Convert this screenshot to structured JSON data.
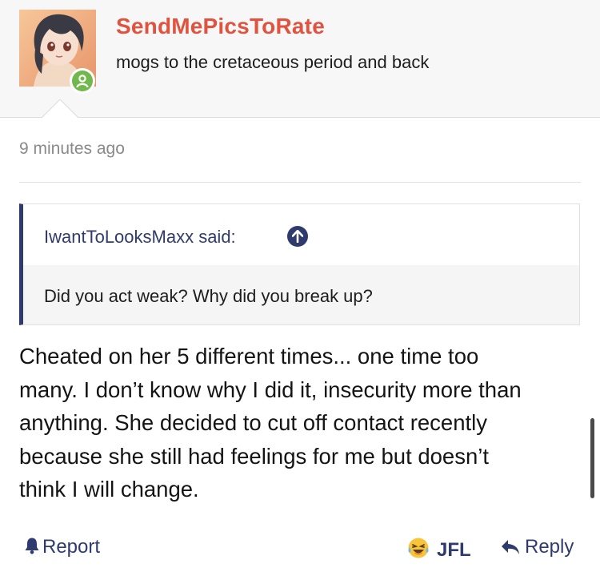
{
  "header": {
    "username": "SendMePicsToRate",
    "user_title": "mogs to the cretaceous period and back",
    "status": "online"
  },
  "post": {
    "timestamp": "9 minutes ago",
    "quote": {
      "author_label": "IwantToLooksMaxx said:",
      "text": "Did you act weak? Why did you break up?"
    },
    "body_lines": [
      "Cheated on her 5 different times... one time too",
      "many. I don’t know why I did it, insecurity more than",
      "anything. She decided to cut off contact recently",
      "because she still had feelings for me but doesn’t",
      "think I will change."
    ]
  },
  "footer": {
    "report_label": "Report",
    "reaction_label": "JFL",
    "reply_label": "Reply"
  },
  "colors": {
    "username": "#e0533e",
    "accent": "#2f3b6e",
    "online": "#71b84d"
  },
  "icons": {
    "online_badge": "user-icon",
    "quote_jump": "arrow-up-icon",
    "report": "bell-icon",
    "reaction": "laughing-tears-emoji-icon",
    "reply": "reply-arrow-icon"
  }
}
